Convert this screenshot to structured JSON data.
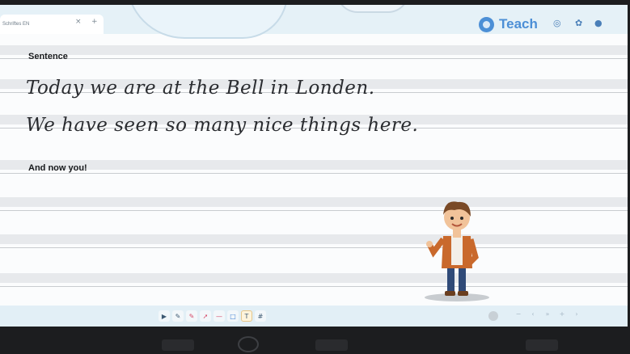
{
  "tab": {
    "title": "Schriftes EN",
    "close": "×",
    "add": "+"
  },
  "brand": {
    "name": "Teach"
  },
  "toolbar_icons": [
    "info-icon",
    "refresh-icon",
    "settings-icon"
  ],
  "lines": {
    "heading1": "Sentence",
    "line1": "Today we are at the Bell in Londen.",
    "line2": "We have seen so many nice things here.",
    "heading2": "And now you!"
  },
  "bottom_tools": [
    {
      "name": "pointer-tool-button",
      "glyph": "▶"
    },
    {
      "name": "pen-tool-button",
      "glyph": "✎"
    },
    {
      "name": "marker-tool-button",
      "glyph": "✎"
    },
    {
      "name": "pin-tool-button",
      "glyph": "➚"
    },
    {
      "name": "line-tool-button",
      "glyph": "—"
    },
    {
      "name": "shape-tool-button",
      "glyph": "□"
    },
    {
      "name": "text-tool-button",
      "glyph": "T"
    },
    {
      "name": "grid-tool-button",
      "glyph": "#"
    }
  ],
  "pager": [
    "−",
    "‹",
    "»",
    "+",
    "›"
  ],
  "colors": {
    "accent": "#4c8fd6",
    "bar": "#e5f1f7",
    "paper_line": "#e7e9ec"
  }
}
